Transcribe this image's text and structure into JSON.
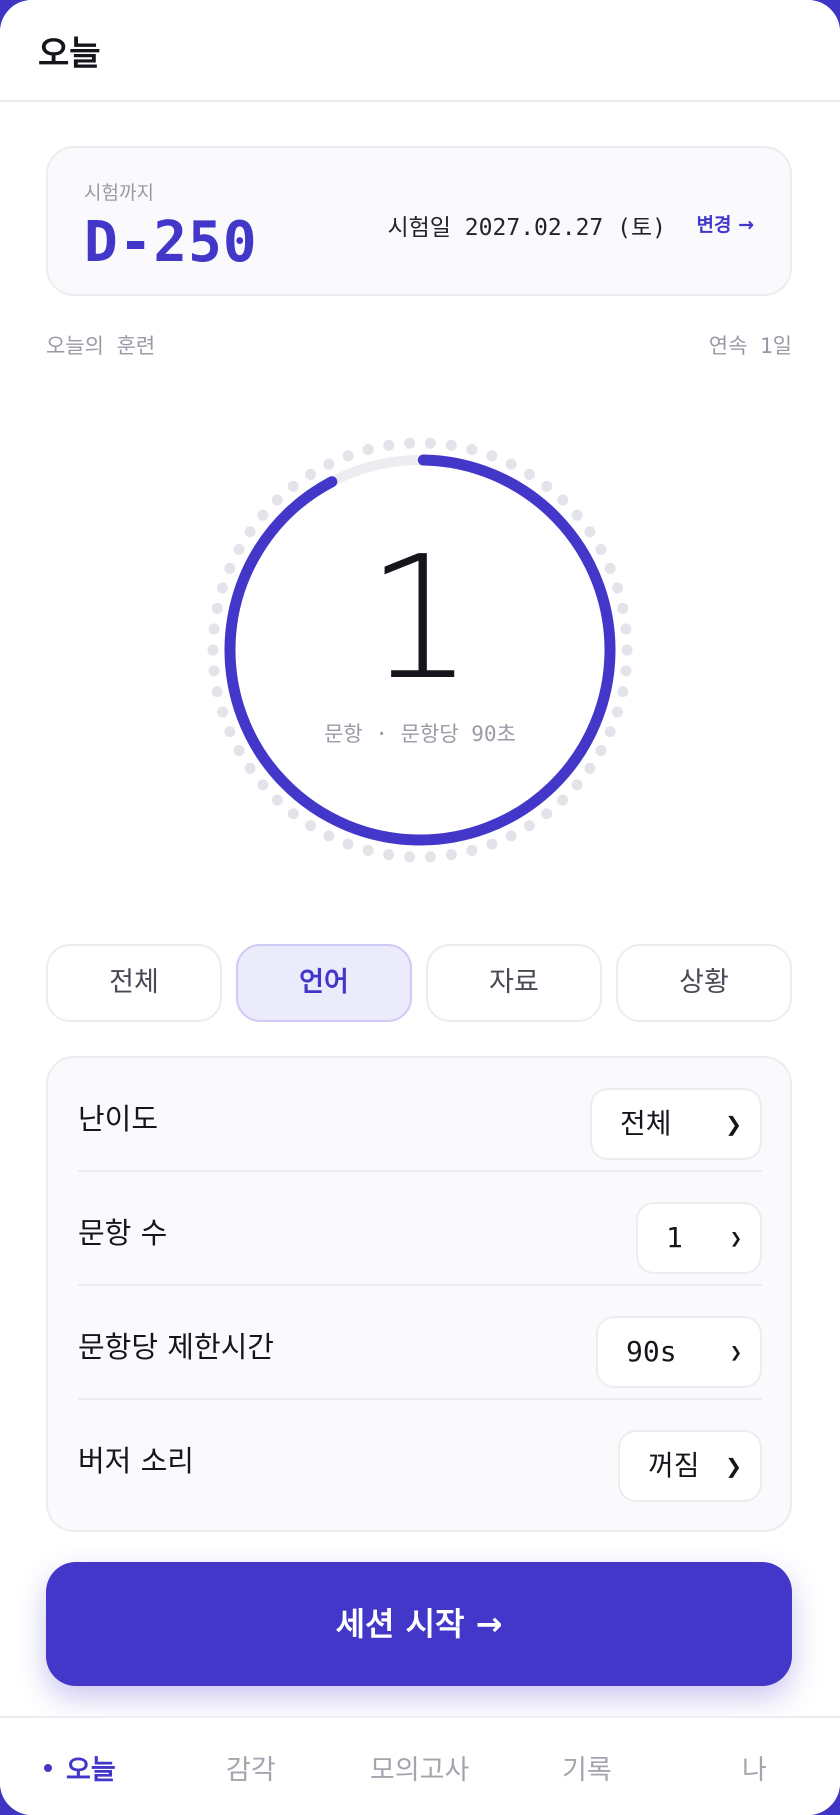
{
  "header": {
    "title": "오늘"
  },
  "dday": {
    "label": "시험까지",
    "value": "D-250",
    "exam_date": "시험일 2027.02.27 (토)",
    "change_label": "변경 →"
  },
  "today": {
    "section_label": "오늘의 훈련",
    "streak": "연속 1일",
    "progress": 0.92
  },
  "ring": {
    "count": "1",
    "caption": "문항 · 문항당 90초"
  },
  "tabs": [
    {
      "label": "전체"
    },
    {
      "label": "언어"
    },
    {
      "label": "자료"
    },
    {
      "label": "상황"
    }
  ],
  "active_tab": "언어",
  "settings": {
    "difficulty": {
      "label": "난이도",
      "value": "전체"
    },
    "count": {
      "label": "문항 수",
      "value": "1"
    },
    "time_limit": {
      "label": "문항당 제한시간",
      "value": "90s"
    },
    "buzzer": {
      "label": "버저 소리",
      "value": "꺼짐"
    }
  },
  "start_button": {
    "label": "세션 시작 →"
  },
  "nav": [
    {
      "label": "오늘"
    },
    {
      "label": "감각"
    },
    {
      "label": "모의고사"
    },
    {
      "label": "기록"
    },
    {
      "label": "나"
    }
  ],
  "colors": {
    "accent": "#4237c9",
    "track": "#ececf1",
    "dots": "#e3e3ea"
  }
}
